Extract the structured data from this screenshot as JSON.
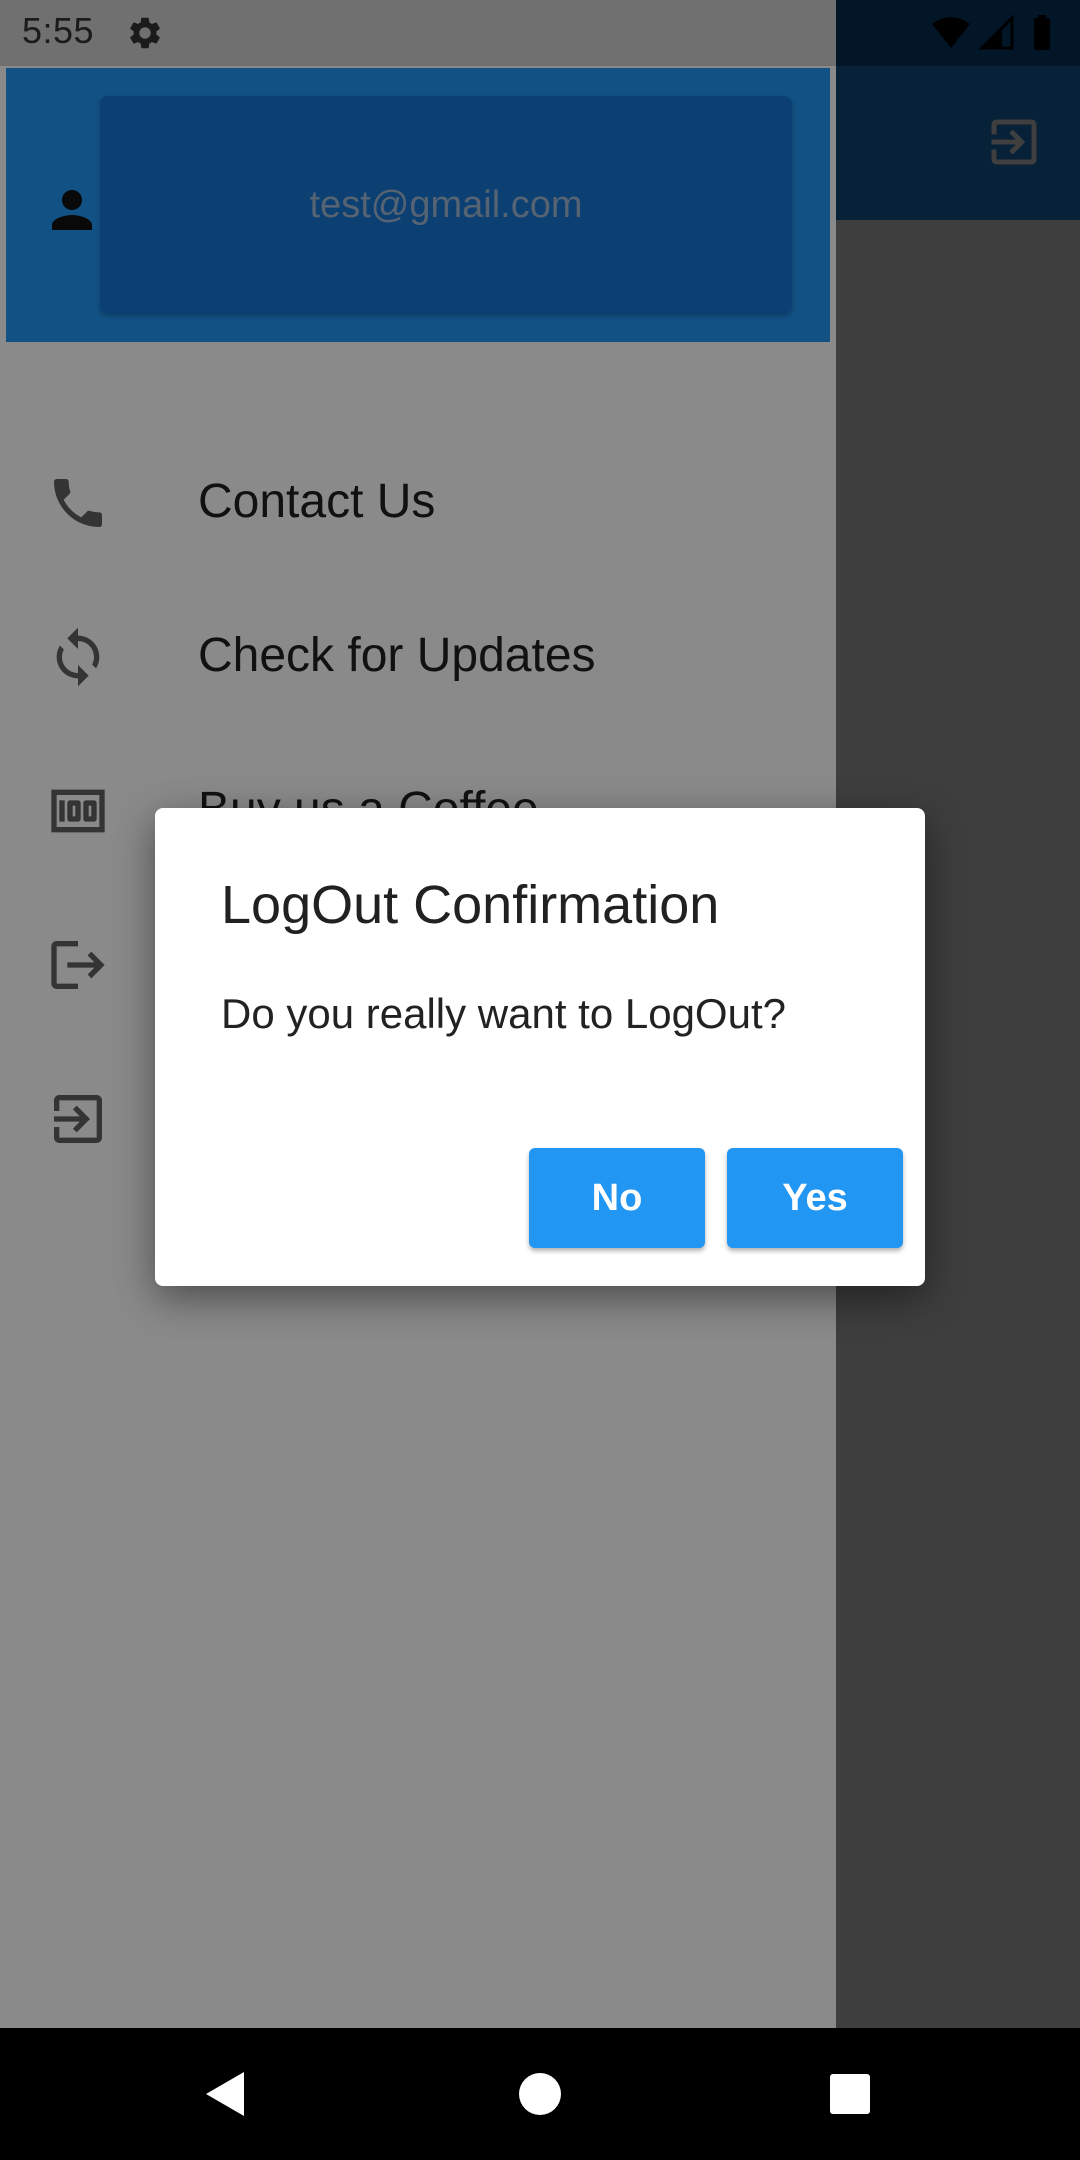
{
  "status_bar": {
    "time": "5:55",
    "icons": [
      "gear-icon",
      "wifi-icon",
      "signal-icon",
      "battery-icon"
    ]
  },
  "app_bar": {
    "action_icon": "login-icon"
  },
  "drawer": {
    "header": {
      "avatar_icon": "person-icon",
      "email": "test@gmail.com"
    },
    "items": [
      {
        "label": "Contact Us",
        "icon": "phone-icon"
      },
      {
        "label": "Check for Updates",
        "icon": "sync-icon"
      },
      {
        "label": "Buy us a Coffee",
        "icon": "money-icon"
      },
      {
        "label": "",
        "icon": "logout-icon"
      },
      {
        "label": "",
        "icon": "login-icon"
      }
    ]
  },
  "dialog": {
    "title": "LogOut Confirmation",
    "message": "Do you really want to LogOut?",
    "no_label": "No",
    "yes_label": "Yes"
  },
  "colors": {
    "primary": "#2196f3",
    "primary_dark": "#1976d2"
  },
  "nav_bar": {
    "buttons": [
      "back-icon",
      "home-icon",
      "recents-icon"
    ]
  }
}
